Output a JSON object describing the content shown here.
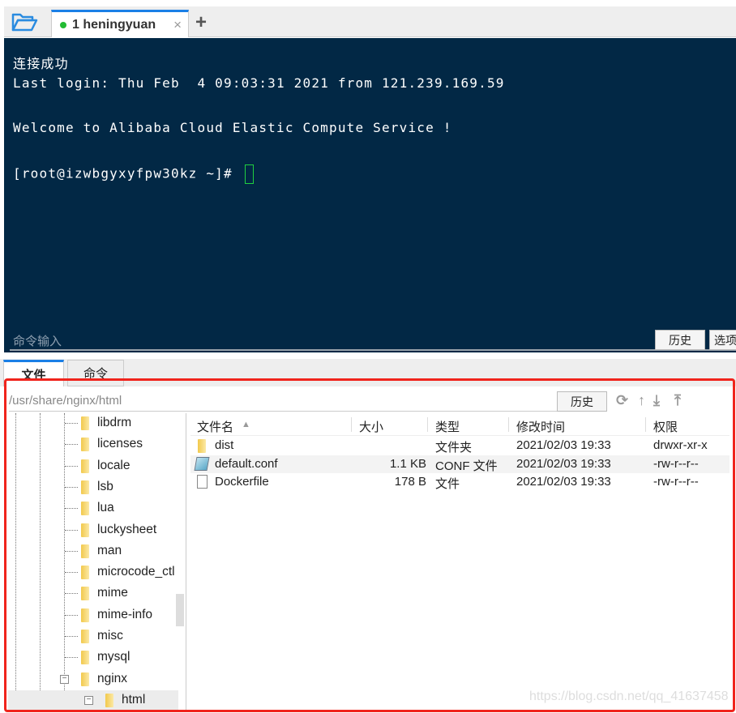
{
  "tabbar": {
    "folder_icon": "folder-open-icon",
    "tab_title": "1 heningyuan",
    "close": "×",
    "add": "+",
    "status_color": "#22bb33"
  },
  "terminal": {
    "lines": [
      "连接成功",
      "Last login: Thu Feb  4 09:03:31 2021 from 121.239.169.59",
      "",
      "Welcome to Alibaba Cloud Elastic Compute Service !",
      "",
      "[root@izwbgyxyfpw30kz ~]# "
    ],
    "command_placeholder": "命令输入",
    "history_btn": "历史",
    "options_btn": "选项",
    "bg": "#022845"
  },
  "bottom_tabs": [
    "文件",
    "命令"
  ],
  "filebar": {
    "path": "/usr/share/nginx/html",
    "history_btn": "历史",
    "icons": [
      "refresh-icon",
      "up-dir-icon",
      "download-icon",
      "upload-icon"
    ]
  },
  "tree": {
    "items": [
      "libdrm",
      "licenses",
      "locale",
      "lsb",
      "lua",
      "luckysheet",
      "man",
      "microcode_ctl",
      "mime",
      "mime-info",
      "misc",
      "mysql",
      "nginx",
      "html"
    ]
  },
  "list": {
    "columns": [
      "文件名",
      "大小",
      "类型",
      "修改时间",
      "权限"
    ],
    "rows": [
      {
        "name": "dist",
        "size": "",
        "type": "文件夹",
        "mtime": "2021/02/03 19:33",
        "perm": "drwxr-xr-x",
        "icon": "folder-icon"
      },
      {
        "name": "default.conf",
        "size": "1.1 KB",
        "type": "CONF 文件",
        "mtime": "2021/02/03 19:33",
        "perm": "-rw-r--r--",
        "icon": "conf-file-icon"
      },
      {
        "name": "Dockerfile",
        "size": "178 B",
        "type": "文件",
        "mtime": "2021/02/03 19:33",
        "perm": "-rw-r--r--",
        "icon": "file-icon"
      }
    ]
  },
  "watermark": "https://blog.csdn.net/qq_41637458"
}
